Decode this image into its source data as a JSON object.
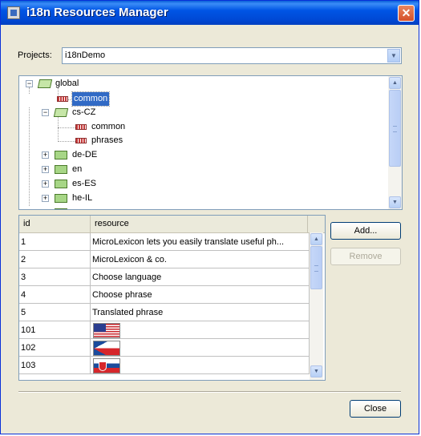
{
  "window": {
    "title": "i18n Resources Manager",
    "close_glyph": "✕"
  },
  "projects": {
    "label": "Projects:",
    "value": "i18nDemo"
  },
  "tree": {
    "nodes": [
      {
        "label": "global"
      },
      {
        "label": "common"
      },
      {
        "label": "cs-CZ"
      },
      {
        "label": "common"
      },
      {
        "label": "phrases"
      },
      {
        "label": "de-DE"
      },
      {
        "label": "en"
      },
      {
        "label": "es-ES"
      },
      {
        "label": "he-IL"
      }
    ]
  },
  "table": {
    "columns": [
      "id",
      "resource"
    ],
    "rows": [
      {
        "id": "1",
        "resource": "MicroLexicon lets you easily translate useful ph..."
      },
      {
        "id": "2",
        "resource": "MicroLexicon & co."
      },
      {
        "id": "3",
        "resource": "Choose language"
      },
      {
        "id": "4",
        "resource": "Choose phrase"
      },
      {
        "id": "5",
        "resource": "Translated phrase"
      },
      {
        "id": "101",
        "resource": "",
        "flag": "us-flag-icon"
      },
      {
        "id": "102",
        "resource": "",
        "flag": "cz-flag-icon"
      },
      {
        "id": "103",
        "resource": "",
        "flag": "sk-flag-icon"
      }
    ]
  },
  "buttons": {
    "add": "Add...",
    "remove": "Remove",
    "close": "Close"
  },
  "colors": {
    "titlebar": "#0055e5",
    "selection": "#316ac5",
    "window_bg": "#ece9d8"
  }
}
